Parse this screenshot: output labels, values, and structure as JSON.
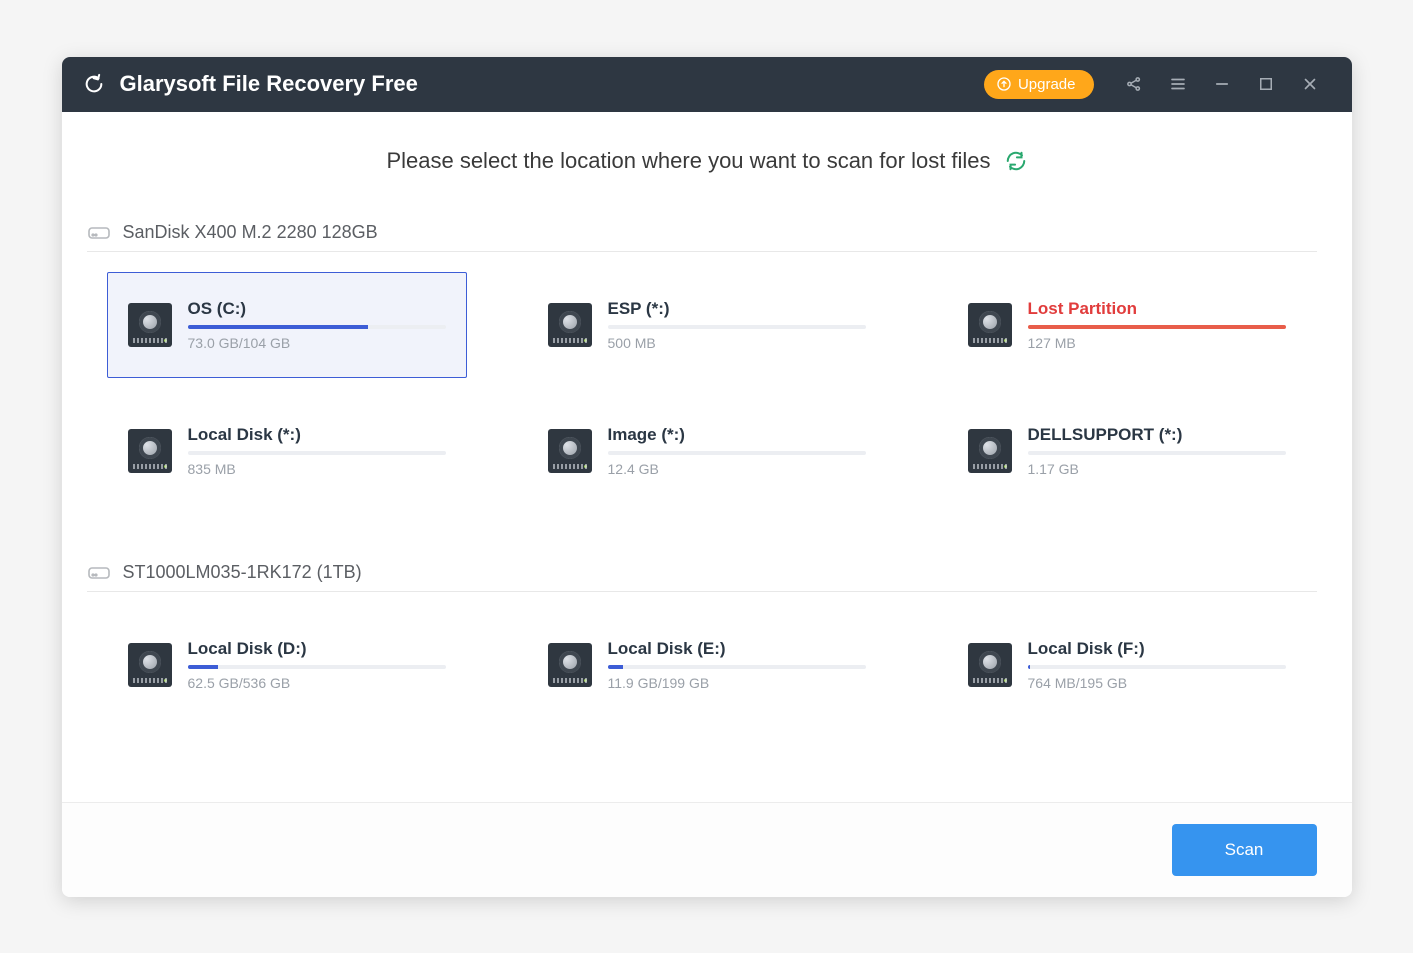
{
  "header": {
    "app_title": "Glarysoft File Recovery Free",
    "upgrade_label": "Upgrade"
  },
  "instruction_text": "Please select the location where you want to scan for lost files",
  "disks": [
    {
      "label": "SanDisk X400 M.2 2280 128GB",
      "partitions": [
        {
          "name": "OS (C:)",
          "size": "73.0 GB/104 GB",
          "fill_pct": 70,
          "selected": true,
          "lost": false
        },
        {
          "name": "ESP (*:)",
          "size": "500 MB",
          "fill_pct": 0,
          "selected": false,
          "lost": false
        },
        {
          "name": "Lost Partition",
          "size": "127 MB",
          "fill_pct": 100,
          "selected": false,
          "lost": true
        },
        {
          "name": "Local Disk (*:)",
          "size": "835 MB",
          "fill_pct": 0,
          "selected": false,
          "lost": false
        },
        {
          "name": "Image (*:)",
          "size": "12.4 GB",
          "fill_pct": 0,
          "selected": false,
          "lost": false
        },
        {
          "name": "DELLSUPPORT (*:)",
          "size": "1.17 GB",
          "fill_pct": 0,
          "selected": false,
          "lost": false
        }
      ]
    },
    {
      "label": "ST1000LM035-1RK172 (1TB)",
      "partitions": [
        {
          "name": "Local Disk (D:)",
          "size": "62.5 GB/536 GB",
          "fill_pct": 12,
          "selected": false,
          "lost": false
        },
        {
          "name": "Local Disk (E:)",
          "size": "11.9 GB/199 GB",
          "fill_pct": 6,
          "selected": false,
          "lost": false
        },
        {
          "name": "Local Disk (F:)",
          "size": "764 MB/195 GB",
          "fill_pct": 1,
          "selected": false,
          "lost": false
        }
      ]
    }
  ],
  "footer": {
    "scan_label": "Scan"
  }
}
